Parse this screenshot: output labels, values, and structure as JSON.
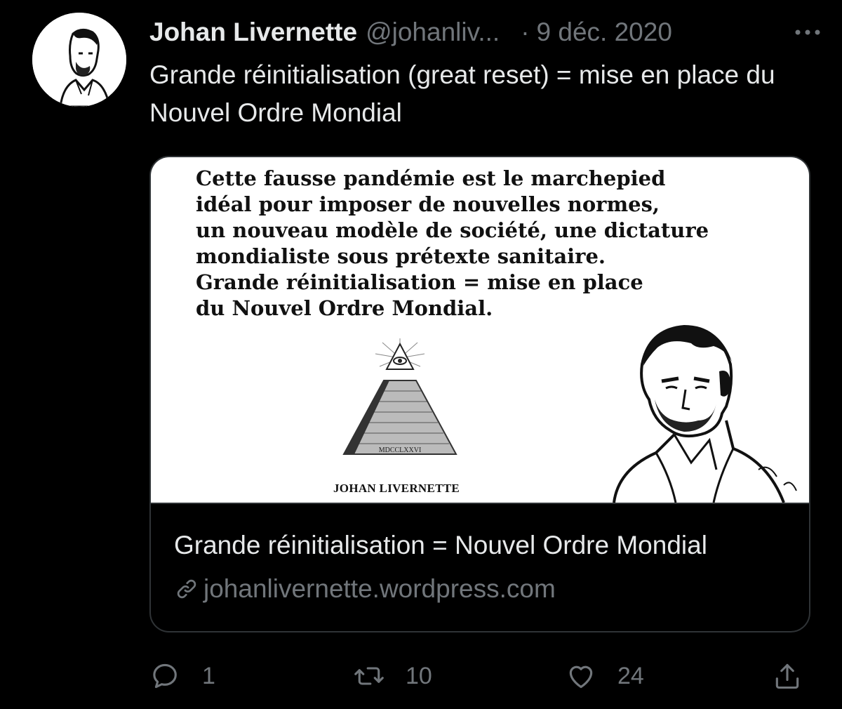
{
  "tweet": {
    "author_name": "Johan Livernette",
    "handle": "@johanliv...",
    "separator": "·",
    "date": "9 déc. 2020",
    "text": "Grande réinitialisation (great reset) = mise en place du Nouvel Ordre Mondial",
    "avatar_icon": "portrait-avatar"
  },
  "card": {
    "image_quote": "Cette fausse pandémie est le marchepied\nidéal pour imposer de nouvelles normes,\nun nouveau modèle de société, une dictature\nmondialiste sous prétexte sanitaire.\nGrande réinitialisation = mise en place\ndu Nouvel Ordre Mondial.",
    "image_brand": "JOHAN LIVERNETTE",
    "pyramid_inscription": "MDCCLXXVI",
    "title": "Grande réinitialisation = Nouvel Ordre Mondial",
    "domain": "johanlivernette.wordpress.com",
    "domain_icon": "link-icon"
  },
  "actions": {
    "reply": {
      "icon": "reply-icon",
      "count": "1"
    },
    "retweet": {
      "icon": "retweet-icon",
      "count": "10"
    },
    "like": {
      "icon": "heart-icon",
      "count": "24"
    },
    "share": {
      "icon": "share-icon"
    }
  },
  "colors": {
    "background": "#000000",
    "text": "#e7e9ea",
    "secondary": "#71767b",
    "border": "#2f3336"
  }
}
